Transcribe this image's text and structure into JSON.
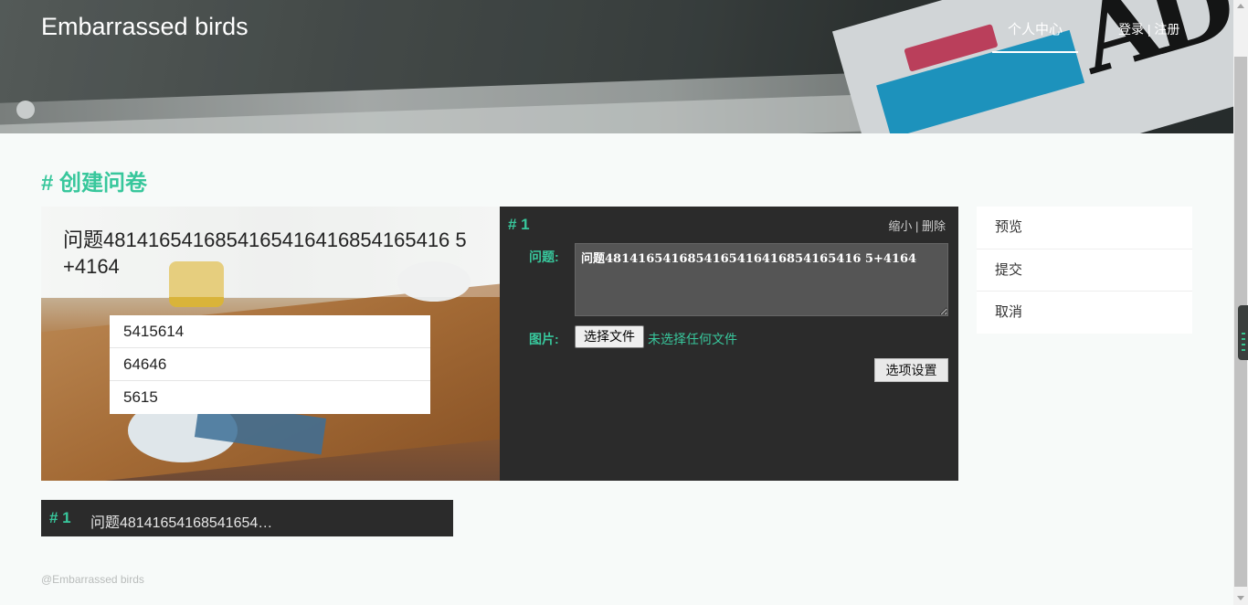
{
  "header": {
    "brand": "Embarrassed birds",
    "nav_personal": "个人中心",
    "login": "登录",
    "separator": "|",
    "register": "注册"
  },
  "page_title": "# 创建问卷",
  "preview": {
    "question": "问题4814165416854165416416854165416 5+4164",
    "options": [
      "5415614",
      "64646",
      "5615"
    ]
  },
  "editor": {
    "number": "# 1",
    "shrink": "缩小",
    "separator": "|",
    "delete": "删除",
    "question_label": "问题:",
    "question_value": "问题4814165416854165416416854165416 5+4164",
    "image_label": "图片:",
    "file_button": "选择文件",
    "file_status": "未选择任何文件",
    "options_button": "选项设置"
  },
  "side_menu": {
    "items": [
      "预览",
      "提交",
      "取消"
    ]
  },
  "collapsed": {
    "number": "# 1",
    "text": "问题48141654168541654…"
  },
  "footer": "@Embarrassed birds",
  "colors": {
    "accent": "#38c79c",
    "panel_dark": "#2b2b2b"
  }
}
